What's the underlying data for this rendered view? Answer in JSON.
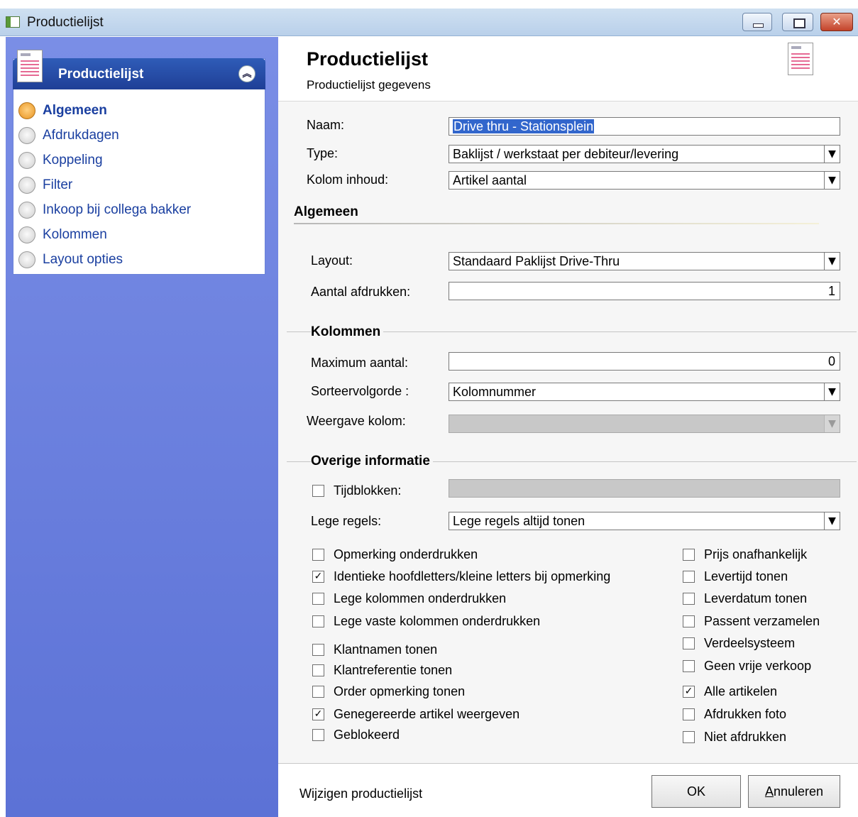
{
  "window": {
    "title": "Productielijst"
  },
  "nav": {
    "header": "Productielijst",
    "items": [
      {
        "label": "Algemeen",
        "active": true
      },
      {
        "label": "Afdrukdagen",
        "active": false
      },
      {
        "label": "Koppeling",
        "active": false
      },
      {
        "label": "Filter",
        "active": false
      },
      {
        "label": "Inkoop bij collega bakker",
        "active": false
      },
      {
        "label": "Kolommen",
        "active": false
      },
      {
        "label": "Layout opties",
        "active": false
      }
    ]
  },
  "header": {
    "title": "Productielijst",
    "subtitle": "Productielijst gegevens"
  },
  "form": {
    "naam_label": "Naam:",
    "naam_value": "Drive thru - Stationsplein",
    "type_label": "Type:",
    "type_value": "Baklijst / werkstaat per debiteur/levering",
    "kolom_inhoud_label": "Kolom inhoud:",
    "kolom_inhoud_value": "Artikel aantal"
  },
  "algemeen": {
    "title": "Algemeen",
    "layout_label": "Layout:",
    "layout_value": "Standaard Paklijst Drive-Thru",
    "aantal_label": "Aantal afdrukken:",
    "aantal_value": "1"
  },
  "kolommen": {
    "title": "Kolommen",
    "max_label": "Maximum aantal:",
    "max_value": "0",
    "sort_label": "Sorteervolgorde :",
    "sort_value": "Kolomnummer",
    "weergave_label": "Weergave kolom:",
    "weergave_value": ""
  },
  "overige": {
    "title": "Overige informatie",
    "tijdblokken_label": "Tijdblokken:",
    "tijdblokken_checked": false,
    "lege_regels_label": "Lege regels:",
    "lege_regels_value": "Lege regels altijd tonen",
    "left_checks": [
      {
        "label": "Opmerking onderdrukken",
        "checked": false
      },
      {
        "label": "Identieke hoofdletters/kleine letters bij opmerking",
        "checked": true
      },
      {
        "label": "Lege kolommen onderdrukken",
        "checked": false
      },
      {
        "label": "Lege vaste kolommen onderdrukken",
        "checked": false
      },
      {
        "label": "Klantnamen tonen",
        "checked": false
      },
      {
        "label": "Klantreferentie tonen",
        "checked": false
      },
      {
        "label": "Order opmerking tonen",
        "checked": false
      },
      {
        "label": "Genegereerde artikel weergeven",
        "checked": true
      },
      {
        "label": "Geblokeerd",
        "checked": false
      }
    ],
    "right_checks": [
      {
        "label": "Prijs onafhankelijk",
        "checked": false
      },
      {
        "label": "Levertijd tonen",
        "checked": false
      },
      {
        "label": "Leverdatum tonen",
        "checked": false
      },
      {
        "label": "Passent verzamelen",
        "checked": false
      },
      {
        "label": "Verdeelsysteem",
        "checked": false
      },
      {
        "label": "Geen vrije verkoop",
        "checked": false
      },
      {
        "label": "Alle artikelen",
        "checked": true
      },
      {
        "label": "Afdrukken foto",
        "checked": false
      },
      {
        "label": "Niet afdrukken",
        "checked": false
      }
    ]
  },
  "footer": {
    "status": "Wijzigen productielijst",
    "ok_label": "OK",
    "cancel_first": "A",
    "cancel_rest": "nnuleren"
  },
  "colors": {
    "nav_gradient_top": "#7a8ee6",
    "nav_header": "#2f5cb8",
    "link_text": "#1a3fa0",
    "selection": "#3266cc"
  }
}
